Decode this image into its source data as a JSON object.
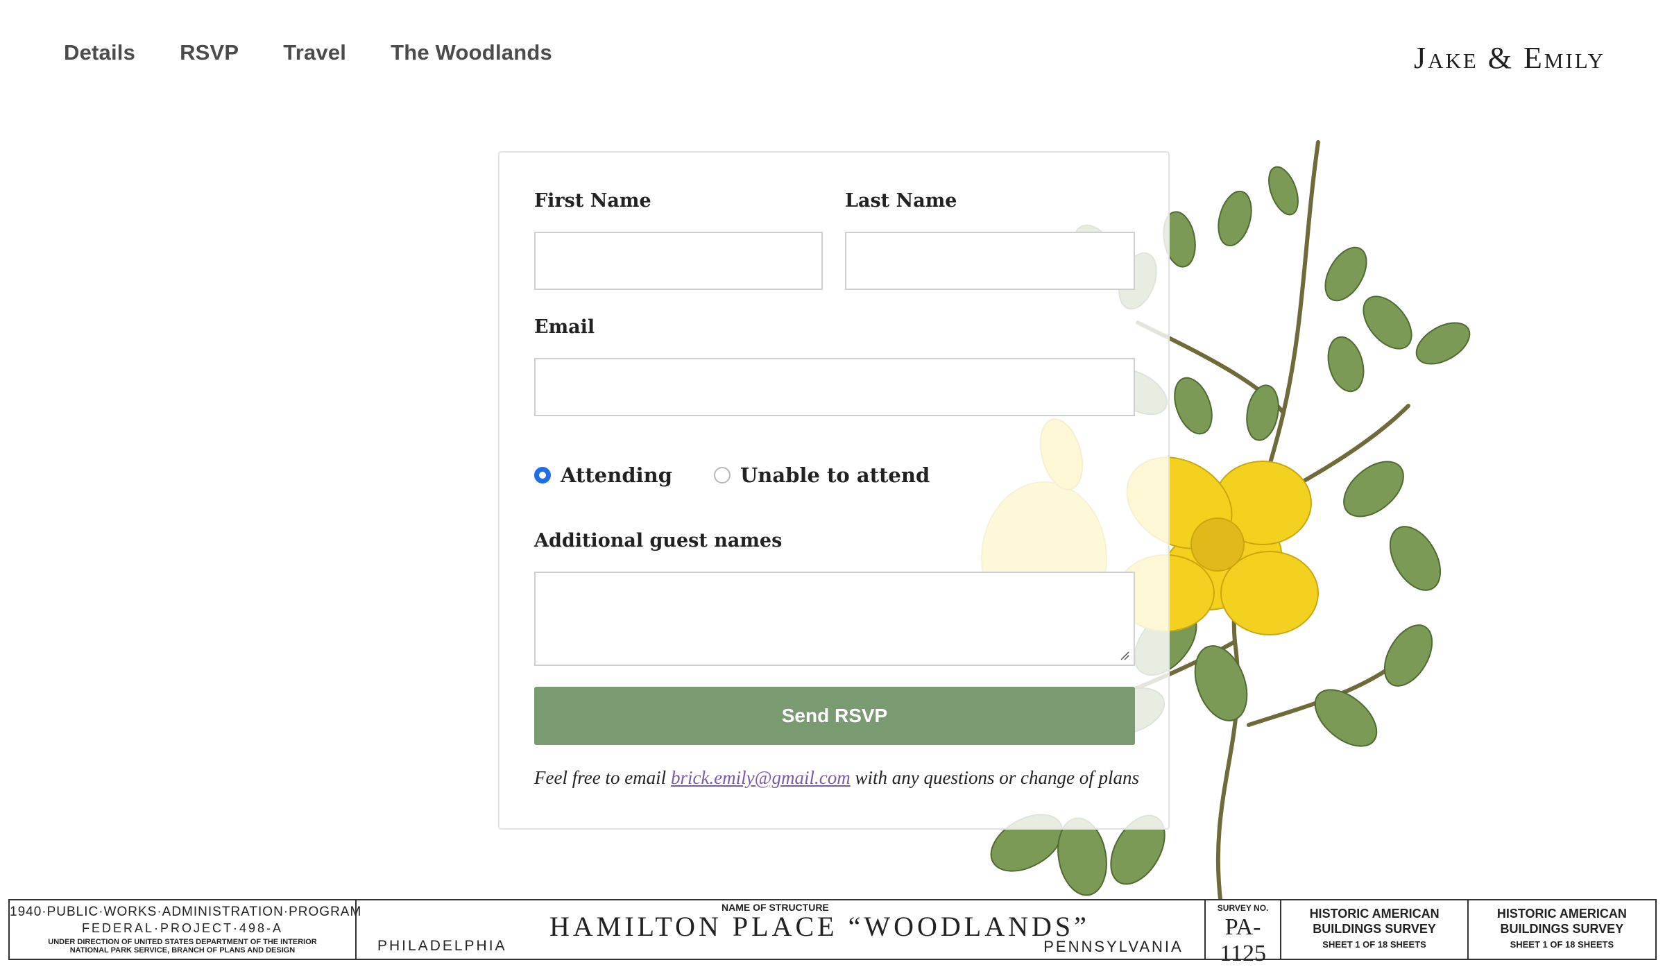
{
  "nav": {
    "items": [
      "Details",
      "RSVP",
      "Travel",
      "The Woodlands"
    ]
  },
  "brand": "Jake & Emily",
  "form": {
    "first_name_label": "First Name",
    "first_name_value": "",
    "last_name_label": "Last Name",
    "last_name_value": "",
    "email_label": "Email",
    "email_value": "",
    "radio": {
      "attending": "Attending",
      "unable": "Unable to attend",
      "selected": "attending"
    },
    "guests_label": "Additional guest names",
    "guests_value": "",
    "submit_label": "Send RSVP",
    "note_prefix": "Feel free to email",
    "note_email": "brick.emily@gmail.com",
    "note_suffix": "with any questions or change of plans"
  },
  "footer": {
    "program_line1": "1940·PUBLIC·WORKS·ADMINISTRATION·PROGRAM",
    "program_line2": "FEDERAL·PROJECT·498-A",
    "program_line3": "UNDER DIRECTION OF UNITED STATES DEPARTMENT OF THE INTERIOR",
    "program_line4": "NATIONAL PARK SERVICE, BRANCH OF PLANS AND DESIGN",
    "city": "PHILADELPHIA",
    "name_of_structure_label": "NAME OF STRUCTURE",
    "structure_name": "HAMILTON PLACE “WOODLANDS”",
    "state": "PENNSYLVANIA",
    "survey_label": "SURVEY NO.",
    "survey_no": "PA-1125",
    "habs_title": "HISTORIC AMERICAN BUILDINGS SURVEY",
    "sheet_text": "SHEET 1 OF 18 SHEETS",
    "habs_title_2": "HISTORIC AMERICAN BUILDINGS SURVEY",
    "sheet_text_2": "SHEET 1 OF 18 SHEETS"
  },
  "colors": {
    "button": "#7a9b72",
    "link": "#7a5aa6",
    "radio_selected": "#1f6ee6",
    "flower_yellow": "#f2d21f",
    "leaf": "#6d8f48"
  }
}
